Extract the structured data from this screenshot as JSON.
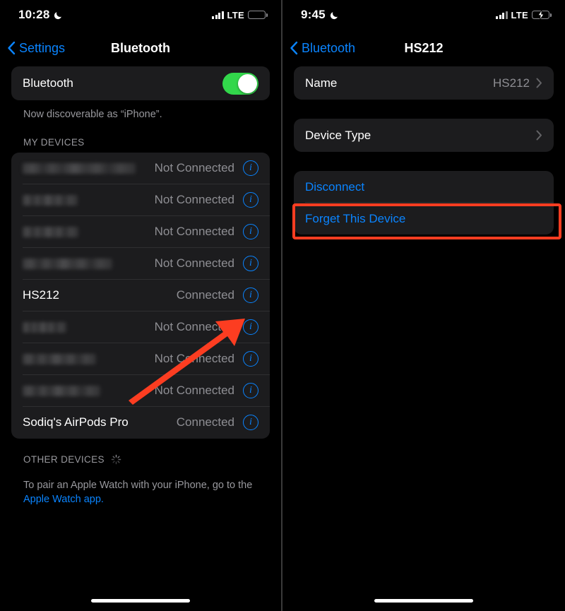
{
  "left": {
    "status_bar": {
      "time": "10:28",
      "moon_icon": "crescent-moon-icon",
      "signal_icon": "cellular-bars-icon",
      "network": "LTE",
      "battery_icon": "battery-low-power-icon"
    },
    "nav": {
      "back_label": "Settings",
      "back_icon": "chevron-left-icon",
      "title": "Bluetooth"
    },
    "bluetooth_toggle": {
      "label": "Bluetooth",
      "state": "on",
      "accent_color": "#32d74b"
    },
    "discoverable_caption": "Now discoverable as “iPhone”.",
    "my_devices_header": "MY DEVICES",
    "devices": [
      {
        "name": "",
        "redacted": true,
        "name_width": 160,
        "status": "Not Connected",
        "info_icon": "info-circle-icon"
      },
      {
        "name": "",
        "redacted": true,
        "name_width": 78,
        "status": "Not Connected",
        "info_icon": "info-circle-icon"
      },
      {
        "name": "",
        "redacted": true,
        "name_width": 79,
        "status": "Not Connected",
        "info_icon": "info-circle-icon"
      },
      {
        "name": "",
        "redacted": true,
        "name_width": 127,
        "status": "Not Connected",
        "info_icon": "info-circle-icon"
      },
      {
        "name": "HS212",
        "redacted": false,
        "name_width": 0,
        "status": "Connected",
        "info_icon": "info-circle-icon"
      },
      {
        "name": "",
        "redacted": true,
        "name_width": 62,
        "status": "Not Connected",
        "info_icon": "info-circle-icon"
      },
      {
        "name": "",
        "redacted": true,
        "name_width": 104,
        "status": "Not Connected",
        "info_icon": "info-circle-icon"
      },
      {
        "name": "",
        "redacted": true,
        "name_width": 110,
        "status": "Not Connected",
        "info_icon": "info-circle-icon"
      },
      {
        "name": "Sodiq's AirPods Pro",
        "redacted": false,
        "name_width": 0,
        "status": "Connected",
        "info_icon": "info-circle-icon"
      }
    ],
    "other_devices_header": "OTHER DEVICES",
    "other_devices_spinner_icon": "activity-spinner-icon",
    "footer_text": "To pair an Apple Watch with your iPhone, go to the",
    "footer_link": "Apple Watch app.",
    "annotation_arrow": {
      "icon": "red-arrow-annotation",
      "color": "#fc3d21",
      "points_to": "info-icon-for-hs212"
    }
  },
  "right": {
    "status_bar": {
      "time": "9:45",
      "moon_icon": "crescent-moon-icon",
      "signal_icon": "cellular-bars-icon",
      "network": "LTE",
      "battery_icon": "battery-charging-icon"
    },
    "nav": {
      "back_label": "Bluetooth",
      "back_icon": "chevron-left-icon",
      "title": "HS212"
    },
    "rows": [
      {
        "label": "Name",
        "value": "HS212",
        "chevron_icon": "chevron-right-icon"
      },
      {
        "label": "Device Type",
        "value": "",
        "chevron_icon": "chevron-right-icon"
      }
    ],
    "actions": [
      {
        "label": "Disconnect",
        "highlighted": true
      },
      {
        "label": "Forget This Device",
        "highlighted": false
      }
    ],
    "annotation_box": {
      "icon": "red-highlight-box",
      "color": "#fc3d21",
      "targets": "Disconnect"
    }
  }
}
